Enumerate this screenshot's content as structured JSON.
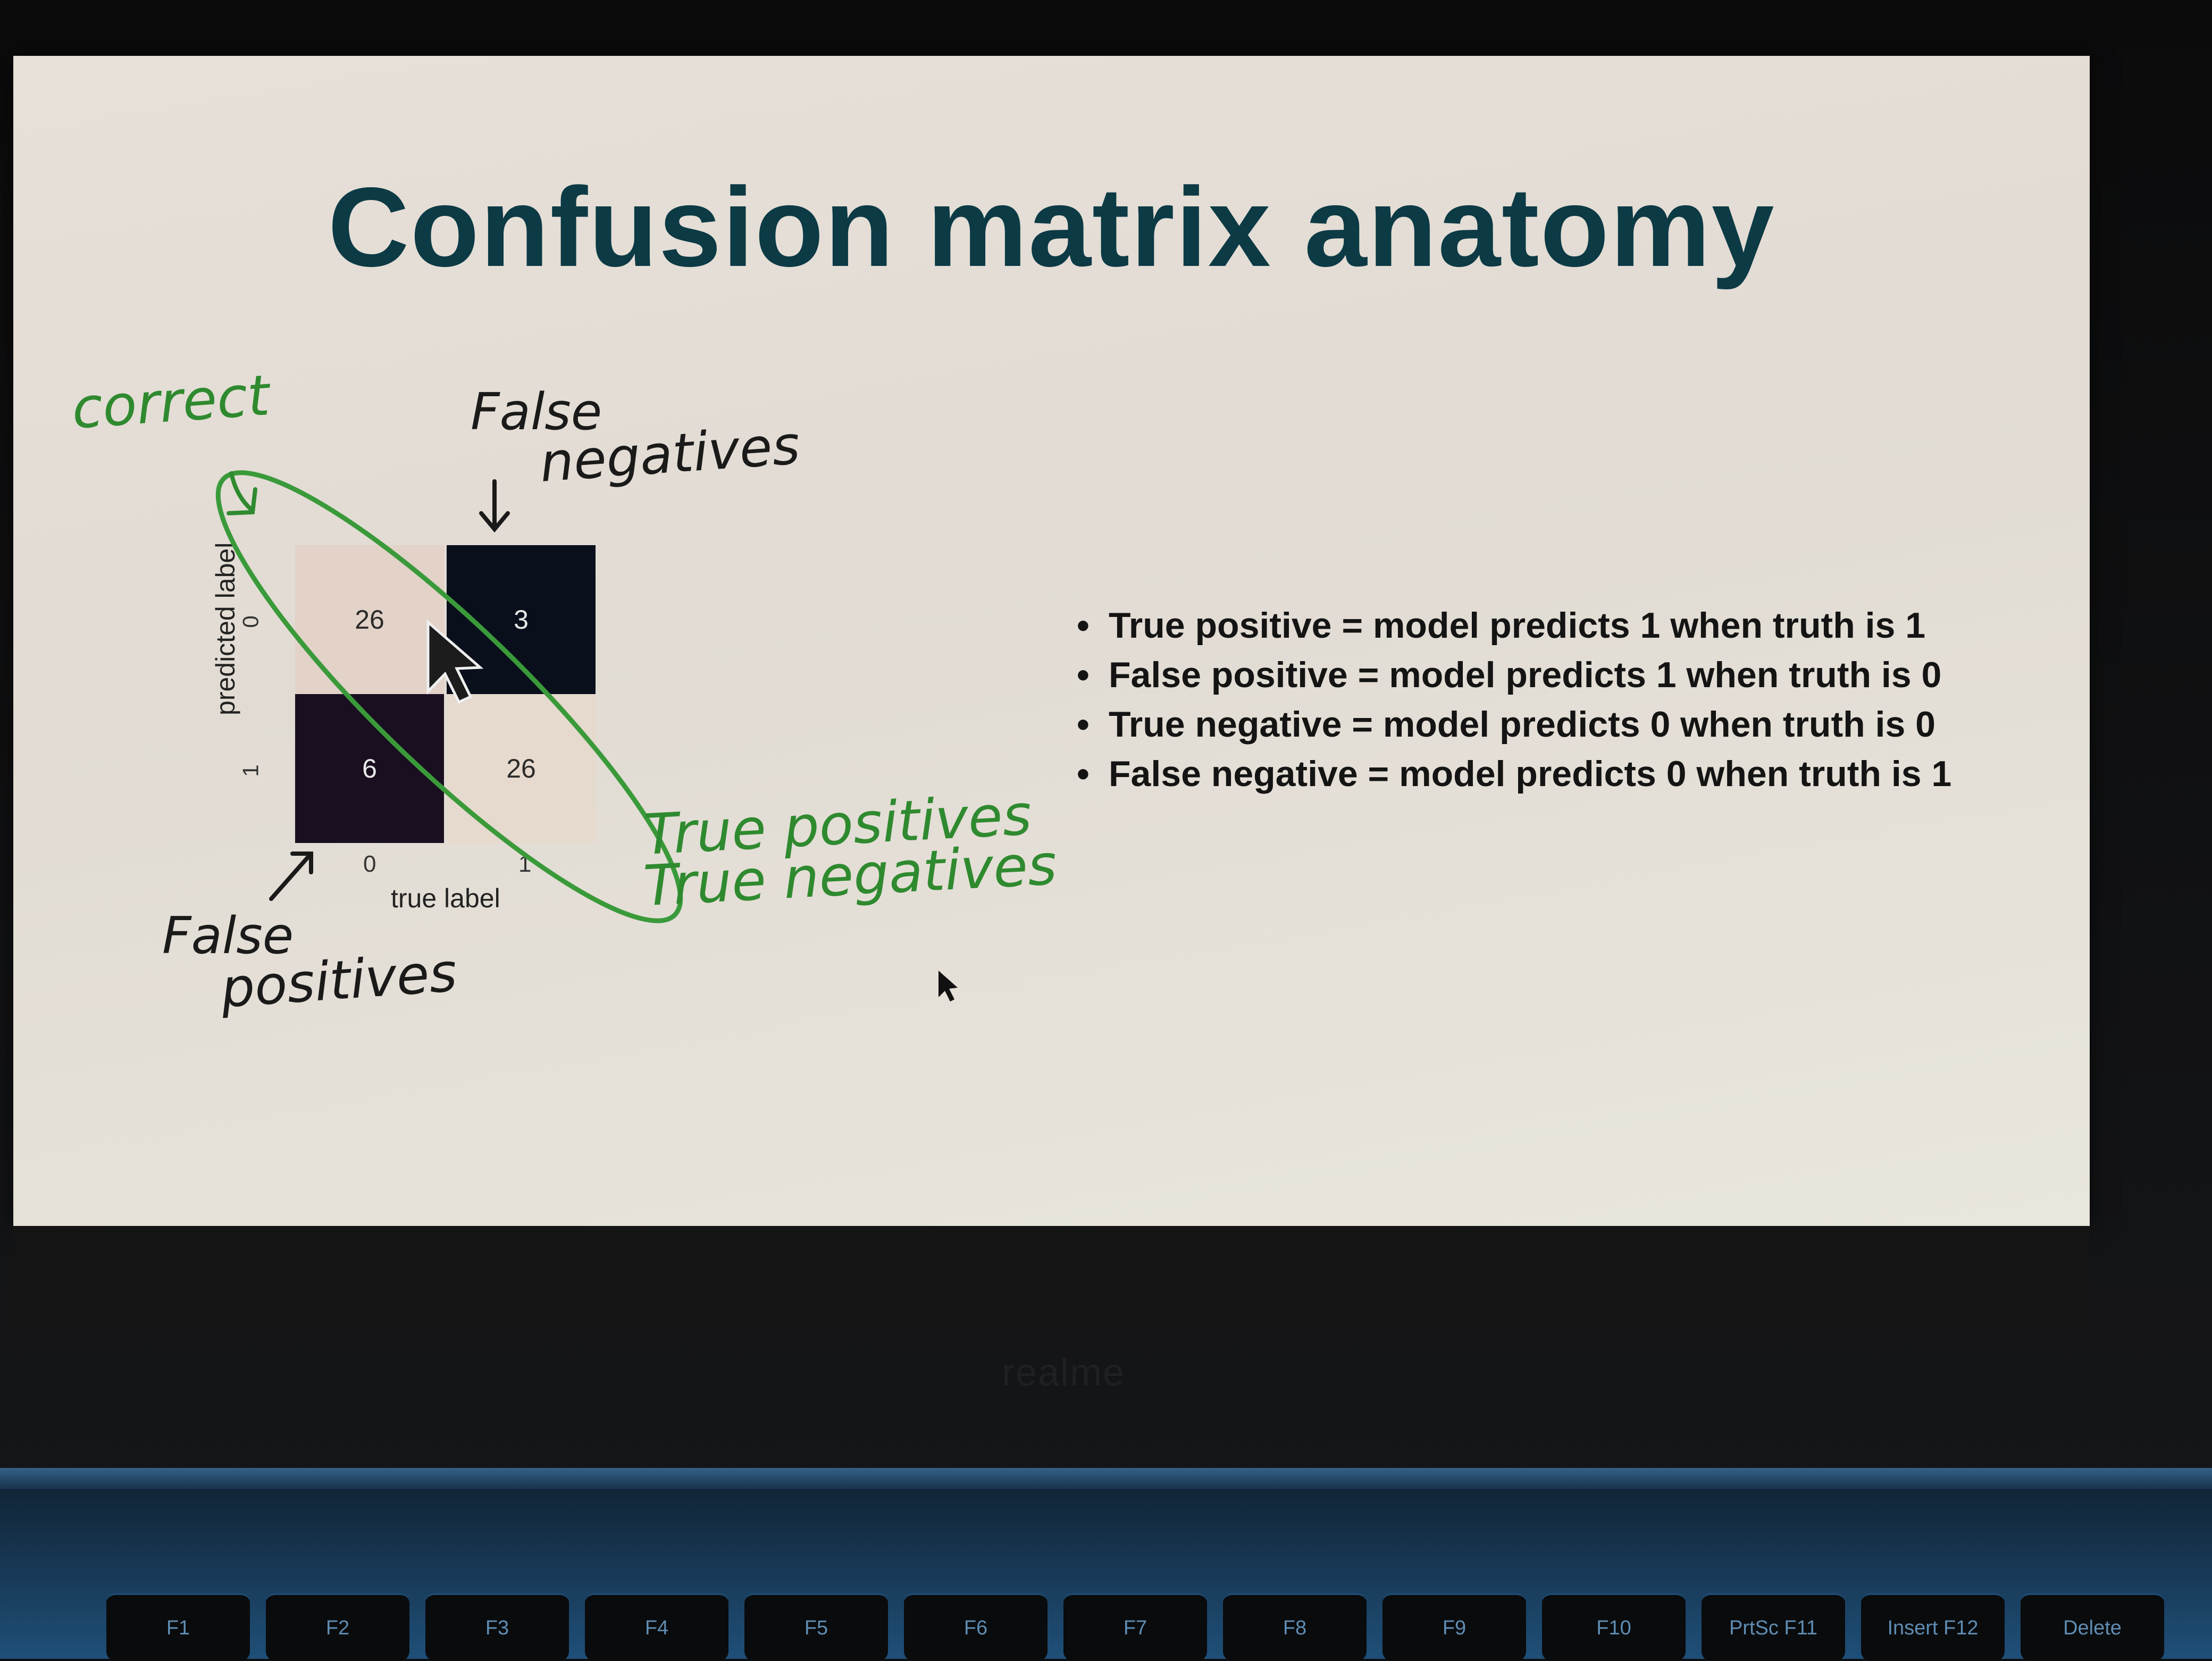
{
  "slide": {
    "title": "Confusion matrix anatomy",
    "bullets": [
      "True positive = model predicts 1 when truth is 1",
      "False positive = model predicts 1 when truth is 0",
      "True negative = model predicts 0 when truth is 0",
      "False negative = model predicts 0 when truth is 1"
    ]
  },
  "matrix": {
    "cells": [
      "26",
      "3",
      "6",
      "26"
    ],
    "cell_colors": [
      "#e2d2c8",
      "#0a0f1c",
      "#1a0f20",
      "#e6d9cd"
    ],
    "text_colors": [
      "#2a2a2a",
      "#e8e8e8",
      "#e8e8e8",
      "#2a2a2a"
    ],
    "y_label": "predicted label",
    "x_label": "true label",
    "y_ticks": [
      "0",
      "1"
    ],
    "x_ticks": [
      "0",
      "1"
    ]
  },
  "annotations": {
    "correct": "correct",
    "false_negatives_1": "False",
    "false_negatives_2": "negatives",
    "true_positives": "True positives",
    "true_negatives": "True negatives",
    "false_positives_1": "False",
    "false_positives_2": "positives"
  },
  "laptop": {
    "brand": "realme",
    "keys": [
      "F1",
      "F2",
      "F3",
      "F4",
      "F5",
      "F6",
      "F7",
      "F8",
      "F9",
      "F10",
      "PrtSc F11",
      "Insert F12",
      "Delete"
    ]
  },
  "colors": {
    "title": "#0c3a45",
    "annotation_green": "#2f8a2f"
  }
}
